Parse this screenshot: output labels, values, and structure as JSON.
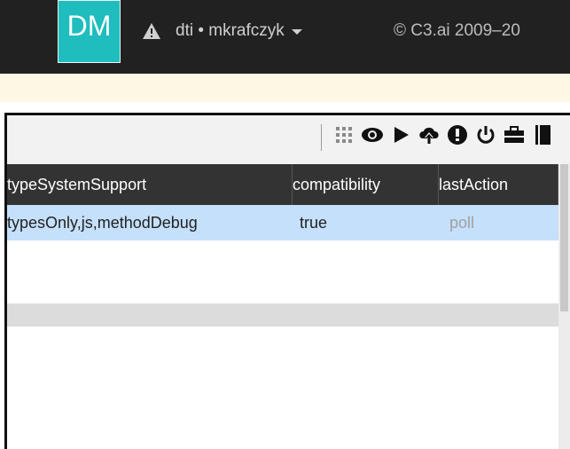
{
  "topbar": {
    "logo_text": "DM",
    "env_label": "dti • mkrafczyk",
    "copyright": "© C3.ai 2009–20"
  },
  "toolbar": {
    "icons": [
      "grid-icon",
      "eye-icon",
      "play-icon",
      "upload-cloud-icon",
      "alert-icon",
      "power-icon",
      "briefcase-icon",
      "notebook-icon"
    ]
  },
  "table": {
    "columns": [
      "typeSystemSupport",
      "compatibility",
      "lastAction"
    ],
    "rows": [
      [
        "typesOnly,js,methodDebug",
        "true",
        "poll"
      ]
    ]
  },
  "colors": {
    "topbar_bg": "#212121",
    "logo_bg": "#1fbdbd",
    "notice_bg": "#fcf8e3",
    "header_bg": "#333333",
    "selected_row_bg": "#c5e0fb",
    "muted_text": "#a0a0a0"
  }
}
